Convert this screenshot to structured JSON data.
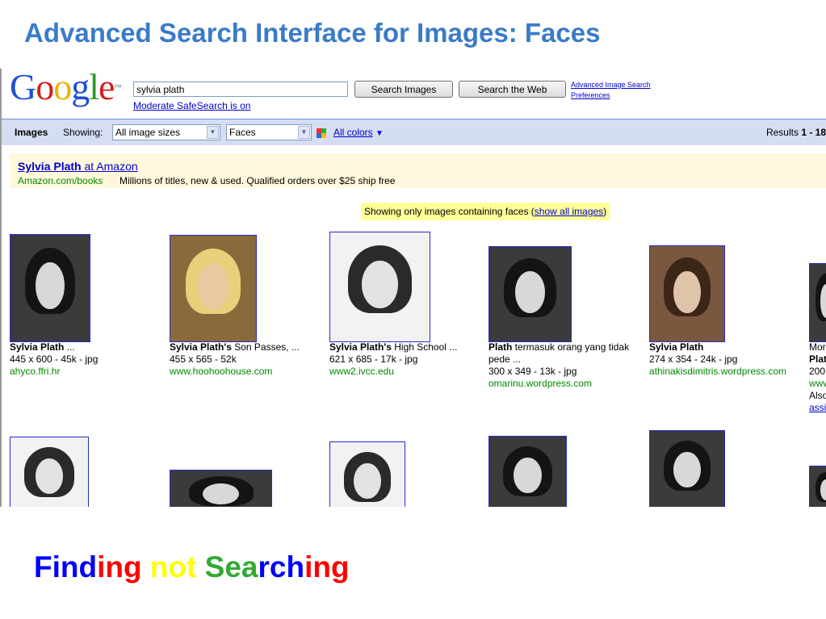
{
  "slide": {
    "title": "Advanced Search Interface for Images: Faces",
    "bottom_text": [
      {
        "t": "Find",
        "c": "#0000ff"
      },
      {
        "t": "i",
        "c": "#ff0000"
      },
      {
        "t": "ng",
        "c": "#ff0000"
      },
      {
        "t": " ",
        "c": "#000000"
      },
      {
        "t": "not",
        "c": "#ffff00"
      },
      {
        "t": " ",
        "c": "#000000"
      },
      {
        "t": "Sea",
        "c": "#33aa33"
      },
      {
        "t": "rch",
        "c": "#0000ff"
      },
      {
        "t": "ing",
        "c": "#ff0000"
      }
    ]
  },
  "logo": {
    "letters": [
      {
        "t": "G",
        "c": "#1f4fd8"
      },
      {
        "t": "o",
        "c": "#d21f1f"
      },
      {
        "t": "o",
        "c": "#e8b400"
      },
      {
        "t": "g",
        "c": "#1f4fd8"
      },
      {
        "t": "l",
        "c": "#2a9a2a"
      },
      {
        "t": "e",
        "c": "#d21f1f"
      }
    ],
    "tm": "™"
  },
  "search": {
    "query": "sylvia plath",
    "search_images_label": "Search Images",
    "search_web_label": "Search the Web",
    "safesearch": "Moderate SafeSearch is on",
    "advanced_link": "Advanced Image Search",
    "preferences_link": "Preferences"
  },
  "filter_bar": {
    "images_label": "Images",
    "showing_label": "Showing:",
    "size_select": "All image sizes",
    "type_select": "Faces",
    "colors_link": "All colors",
    "colors_arrow": "▼",
    "colors_icon": "four-color-squares-icon",
    "results_prefix": "Results ",
    "results_range": "1 - 18"
  },
  "ad": {
    "title_bold": "Sylvia Plath",
    "title_rest": " at Amazon",
    "url": "Amazon.com/books",
    "description": "Millions of titles, new & used. Qualified orders over $25 ship free"
  },
  "faces_notice": {
    "text": "Showing only images containing faces (",
    "link": "show all images",
    "close": ")"
  },
  "results_row1": [
    {
      "title_bold": "Sylvia Plath",
      "title_rest": " ...",
      "meta": "445 x 600 - 45k - jpg",
      "url": "ahyco.ffri.hr",
      "tone": "dark"
    },
    {
      "title_bold": "Sylvia Plath's",
      "title_rest": " Son Passes, ...",
      "meta": "455 x 565 - 52k",
      "url": "www.hoohoohouse.com",
      "tone": "painting"
    },
    {
      "title_bold": "Sylvia Plath's",
      "title_rest": " High School ...",
      "meta": "621 x 685 - 17k - jpg",
      "url": "www2.ivcc.edu",
      "tone": "light"
    },
    {
      "title_bold": "Plath",
      "title_rest": " termasuk orang yang tidak",
      "title_line2": "pede ...",
      "meta": "300 x 349 - 13k - jpg",
      "url": "omarinu.wordpress.com",
      "tone": "dark"
    },
    {
      "title_bold": "Sylvia Plath",
      "title_rest": "",
      "meta": "274 x 354 - 24k - jpg",
      "url": "athinakisdimitris.wordpress.com",
      "tone": "sepia"
    },
    {
      "title_bold": "",
      "title_rest": "Mor",
      "line2_bold": "Plat",
      "meta": "200",
      "url": "www",
      "extra": "Also",
      "link": "assi",
      "tone": "dark"
    }
  ],
  "results_row2_tones": [
    "light",
    "dark",
    "light",
    "dark",
    "dark",
    "dark"
  ]
}
